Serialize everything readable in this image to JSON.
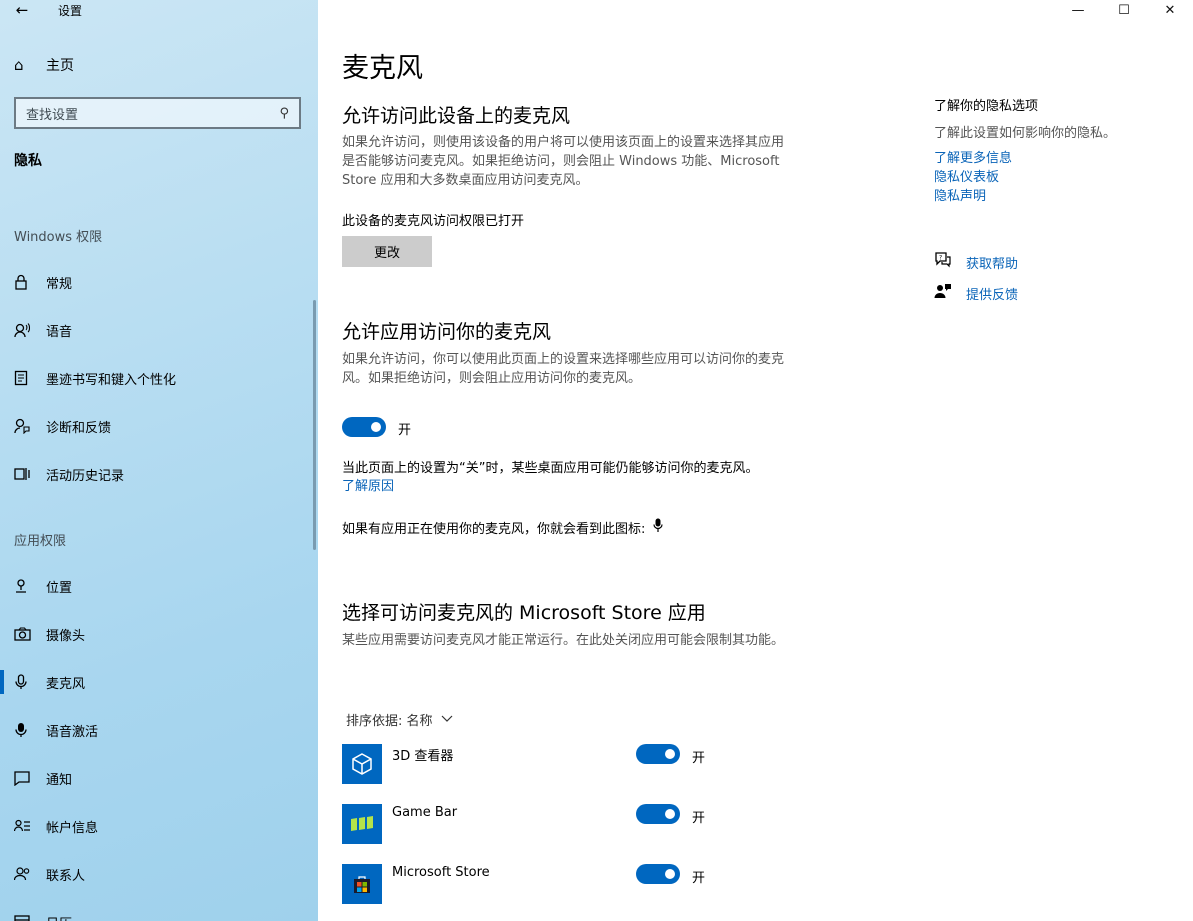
{
  "window": {
    "title": "设置",
    "back_glyph": "←",
    "controls": {
      "minimize": "—",
      "maximize": "☐",
      "close": "✕"
    }
  },
  "sidebar": {
    "home": {
      "icon": "home-icon",
      "label": "主页"
    },
    "search": {
      "placeholder": "查找设置",
      "icon": "search-icon"
    },
    "section": "隐私",
    "windows_group": {
      "label": "Windows 权限",
      "items": [
        {
          "icon": "lock-icon",
          "glyph": "🔒",
          "label": "常规"
        },
        {
          "icon": "speech-icon",
          "glyph": "♫",
          "label": "语音"
        },
        {
          "icon": "notepad-icon",
          "glyph": "▤",
          "label": "墨迹书写和键入个性化"
        },
        {
          "icon": "feedback-person-icon",
          "glyph": "⚲",
          "label": "诊断和反馈"
        },
        {
          "icon": "timeline-icon",
          "glyph": "▦",
          "label": "活动历史记录"
        }
      ]
    },
    "app_group": {
      "label": "应用权限",
      "items": [
        {
          "icon": "location-icon",
          "glyph": "⚐",
          "label": "位置"
        },
        {
          "icon": "camera-icon",
          "glyph": "◙",
          "label": "摄像头"
        },
        {
          "icon": "microphone-icon",
          "glyph": "🎙",
          "label": "麦克风",
          "active": true
        },
        {
          "icon": "voice-activation-icon",
          "glyph": "🎤",
          "label": "语音激活"
        },
        {
          "icon": "notification-icon",
          "glyph": "▭",
          "label": "通知"
        },
        {
          "icon": "account-info-icon",
          "glyph": "☷",
          "label": "帐户信息"
        },
        {
          "icon": "contacts-icon",
          "glyph": "☺",
          "label": "联系人"
        },
        {
          "icon": "calendar-icon",
          "glyph": "▥",
          "label": "日历"
        }
      ]
    }
  },
  "main": {
    "title": "麦克风",
    "device_section": {
      "heading": "允许访问此设备上的麦克风",
      "description": "如果允许访问，则使用该设备的用户将可以使用该页面上的设置来选择其应用是否能够访问麦克风。如果拒绝访问，则会阻止 Windows 功能、Microsoft Store 应用和大多数桌面应用访问麦克风。",
      "status": "此设备的麦克风访问权限已打开",
      "change_button": "更改"
    },
    "apps_section": {
      "heading": "允许应用访问你的麦克风",
      "description": "如果允许访问，你可以使用此页面上的设置来选择哪些应用可以访问你的麦克风。如果拒绝访问，则会阻止应用访问你的麦克风。",
      "toggle_state": "开",
      "note": "当此页面上的设置为“关”时，某些桌面应用可能仍能够访问你的麦克风。",
      "learn_why": "了解原因",
      "icon_note": "如果有应用正在使用你的麦克风，你就会看到此图标:"
    },
    "store_section": {
      "heading": "选择可访问麦克风的 Microsoft Store 应用",
      "description": "某些应用需要访问麦克风才能正常运行。在此处关闭应用可能会限制其功能。",
      "sort_label": "排序依据: 名称",
      "apps": [
        {
          "name": "3D 查看器",
          "icon": "cube-icon",
          "state": "开"
        },
        {
          "name": "Game Bar",
          "icon": "gamebar-icon",
          "state": "开"
        },
        {
          "name": "Microsoft Store",
          "icon": "store-bag-icon",
          "state": "开"
        }
      ]
    }
  },
  "right": {
    "title": "了解你的隐私选项",
    "text": "了解此设置如何影响你的隐私。",
    "links": [
      "了解更多信息",
      "隐私仪表板",
      "隐私声明"
    ],
    "help": {
      "label": "获取帮助",
      "icon": "help-chat-icon"
    },
    "feedback": {
      "label": "提供反馈",
      "icon": "feedback-icon"
    }
  },
  "colors": {
    "accent": "#0067c0",
    "link": "#0a64b8",
    "sidebar": "#b9def2"
  }
}
